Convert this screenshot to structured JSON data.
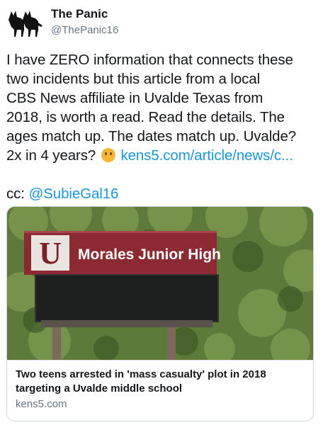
{
  "author": {
    "display_name": "The Panic",
    "handle": "@ThePanic16"
  },
  "tweet": {
    "line1": "I have ZERO information that connects these",
    "line2": "two incidents but this article from a local",
    "line3": "CBS News affiliate in Uvalde Texas from",
    "line4": "2018, is worth a read.  Read the details. The",
    "line5": "ages match up. The dates match up. Uvalde?",
    "line6_pre": "2x in 4 years?",
    "line6_emoji": "thinking-face",
    "link": "kens5.com/article/news/c...",
    "cc_label": "cc:",
    "mention": "@SubieGal16"
  },
  "card": {
    "sign_text": "Morales Junior High",
    "title": "Two teens arrested in 'mass casualty' plot in 2018 targeting a Uvalde middle school",
    "domain": "kens5.com"
  },
  "colors": {
    "link": "#1b95e0",
    "secondary_text": "#657786",
    "sign_maroon": "#8c2a33"
  }
}
